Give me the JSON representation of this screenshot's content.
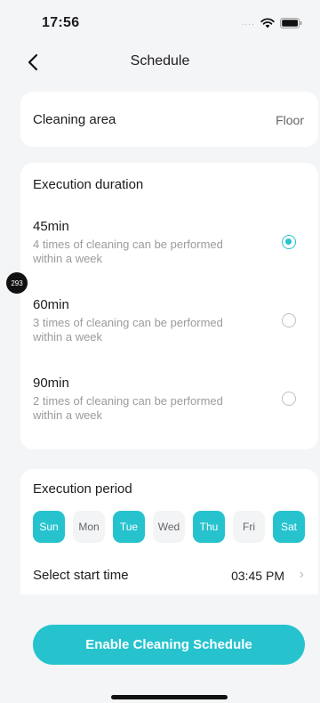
{
  "status_bar": {
    "time": "17:56",
    "signal": "....",
    "icons": [
      "wifi-icon",
      "battery-icon"
    ]
  },
  "nav": {
    "title": "Schedule",
    "back_icon": "chevron-left-icon"
  },
  "cleaning_area": {
    "label": "Cleaning area",
    "value": "Floor"
  },
  "duration": {
    "title": "Execution duration",
    "options": [
      {
        "title": "45min",
        "desc": "4 times of cleaning can be performed within a week",
        "selected": true
      },
      {
        "title": "60min",
        "desc": "3 times of cleaning can be performed within a week",
        "selected": false
      },
      {
        "title": "90min",
        "desc": "2 times of cleaning can be performed within a week",
        "selected": false
      }
    ]
  },
  "period": {
    "title": "Execution period",
    "days": [
      {
        "label": "Sun",
        "active": true
      },
      {
        "label": "Mon",
        "active": false
      },
      {
        "label": "Tue",
        "active": true
      },
      {
        "label": "Wed",
        "active": false
      },
      {
        "label": "Thu",
        "active": true
      },
      {
        "label": "Fri",
        "active": false
      },
      {
        "label": "Sat",
        "active": true
      }
    ],
    "start_label": "Select start time",
    "start_time": "03:45 PM"
  },
  "enable_button": "Enable Cleaning Schedule",
  "badge": "293",
  "colors": {
    "accent": "#26c3cf",
    "background": "#f4f5f7",
    "card": "#ffffff"
  }
}
